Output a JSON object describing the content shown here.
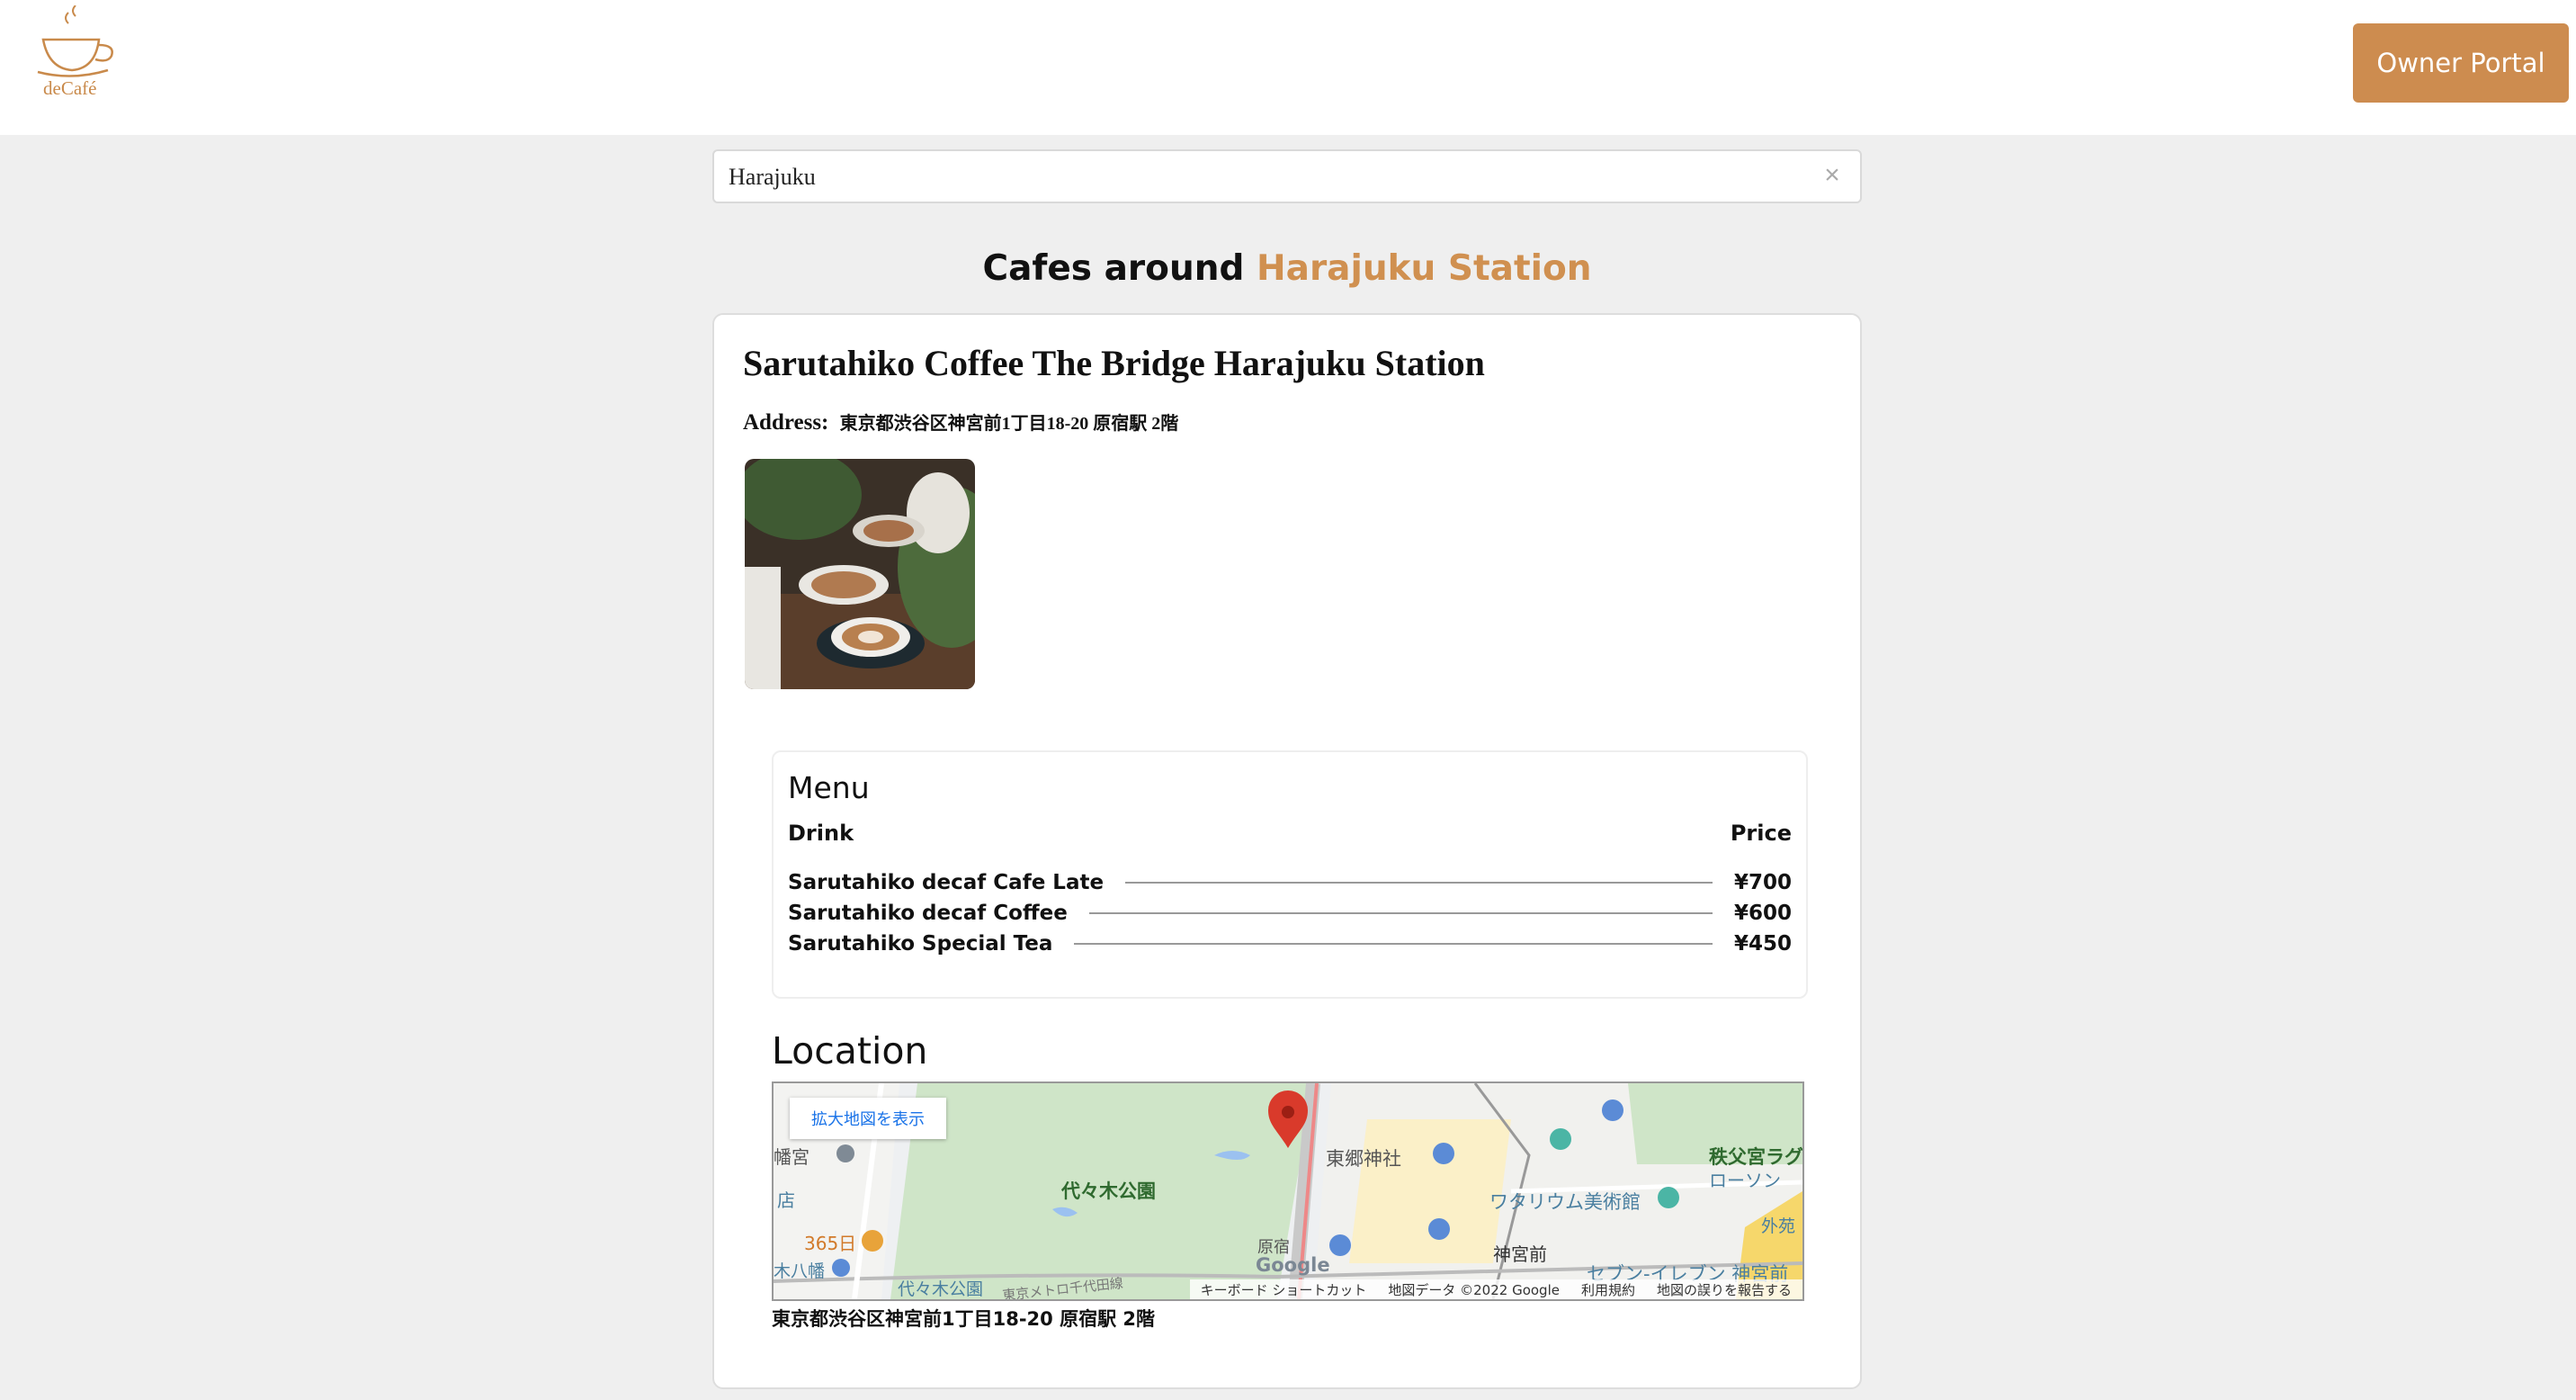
{
  "header": {
    "logo_text": "deCafé",
    "owner_button": "Owner Portal"
  },
  "search": {
    "value": "Harajuku",
    "clear_symbol": "×"
  },
  "heading": {
    "prefix": "Cafes around",
    "station": "Harajuku Station"
  },
  "cafe": {
    "name": "Sarutahiko Coffee The Bridge Harajuku Station",
    "address_label": "Address:",
    "address": "東京都渋谷区神宮前1丁目18-20 原宿駅 2階"
  },
  "menu": {
    "title": "Menu",
    "col_drink": "Drink",
    "col_price": "Price",
    "items": [
      {
        "name": "Sarutahiko decaf Cafe Late",
        "price": "¥700"
      },
      {
        "name": "Sarutahiko decaf Coffee",
        "price": "¥600"
      },
      {
        "name": "Sarutahiko Special Tea",
        "price": "¥450"
      }
    ]
  },
  "location": {
    "title": "Location",
    "address": "東京都渋谷区神宮前1丁目18-20 原宿駅 2階",
    "map": {
      "enlarge_button": "拡大地図を表示",
      "labels": {
        "park": "代々木公園",
        "shrine": "東郷神社",
        "museum": "ワタリウム美術館",
        "jingumae": "神宮前",
        "harajuku": "原宿",
        "seven": "セブン-イレブン 神宮前",
        "shop365": "365日",
        "hachiman": "幡宮",
        "yoyogi_park_station": "代々木公園",
        "chichibu": "秩父宮ラグ",
        "lawson": "ローソン",
        "gaien": "外苑",
        "ten": "店",
        "kihachiman": "木八幡",
        "chiyoda": "東京メトロ千代田線"
      },
      "footer": {
        "shortcuts": "キーボード ショートカット",
        "data": "地図データ ©2022 Google",
        "terms": "利用規約",
        "report": "地図の誤りを報告する"
      },
      "google_logo": "Google"
    }
  },
  "colors": {
    "accent": "#cd8c4f",
    "background": "#efefef"
  }
}
